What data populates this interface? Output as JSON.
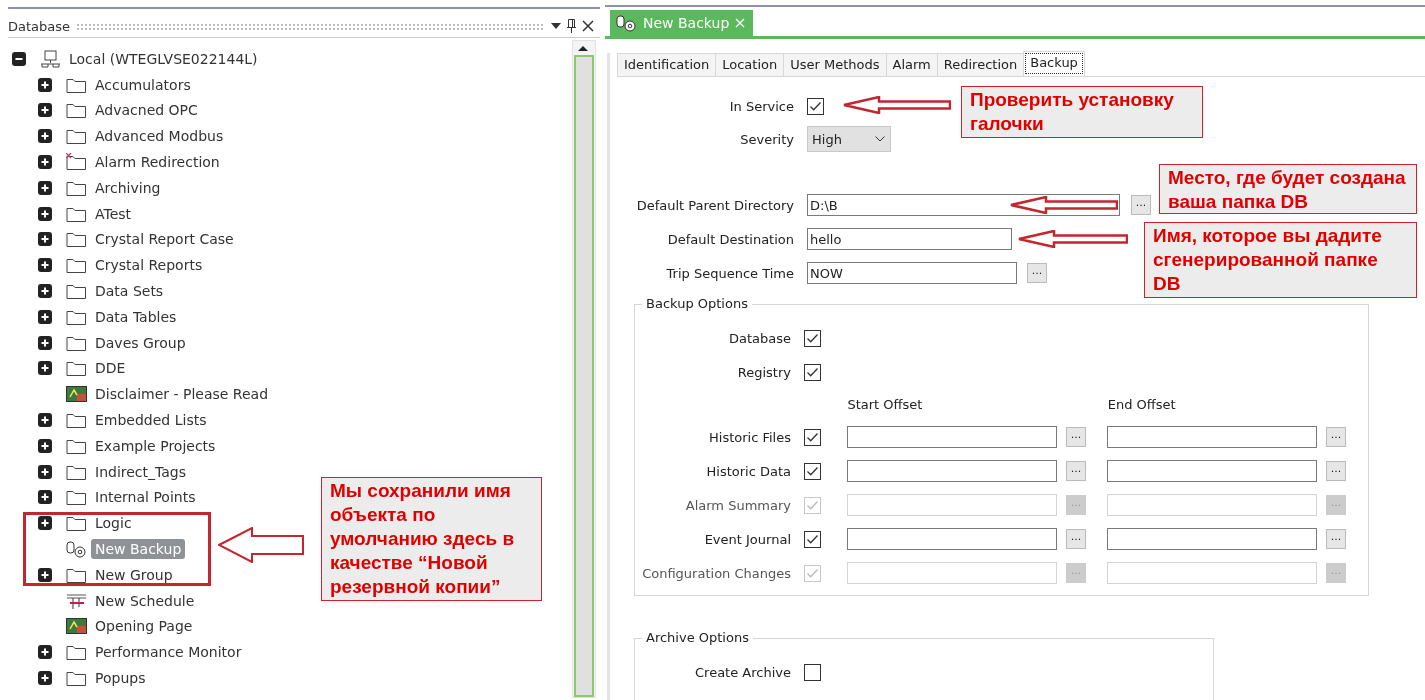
{
  "database_panel": {
    "title": "Database",
    "root": {
      "label": "Local (WTEGLVSE022144L)",
      "expanded": true,
      "children": [
        {
          "label": "Accumulators",
          "kind": "folder",
          "expandable": true,
          "selected": false
        },
        {
          "label": "Advacned OPC",
          "kind": "folder",
          "expandable": true,
          "selected": false
        },
        {
          "label": "Advanced Modbus",
          "kind": "folder",
          "expandable": true,
          "selected": false
        },
        {
          "label": "Alarm Redirection",
          "kind": "marked-folder",
          "expandable": true,
          "selected": false
        },
        {
          "label": "Archiving",
          "kind": "folder",
          "expandable": true,
          "selected": false
        },
        {
          "label": "ATest",
          "kind": "folder",
          "expandable": true,
          "selected": false
        },
        {
          "label": "Crystal Report Case",
          "kind": "folder",
          "expandable": true,
          "selected": false
        },
        {
          "label": "Crystal Reports",
          "kind": "folder",
          "expandable": true,
          "selected": false
        },
        {
          "label": "Data Sets",
          "kind": "folder",
          "expandable": true,
          "selected": false
        },
        {
          "label": "Data Tables",
          "kind": "folder",
          "expandable": true,
          "selected": false
        },
        {
          "label": "Daves Group",
          "kind": "folder",
          "expandable": true,
          "selected": false
        },
        {
          "label": "DDE",
          "kind": "folder",
          "expandable": true,
          "selected": false
        },
        {
          "label": "Disclaimer - Please Read",
          "kind": "page",
          "expandable": false,
          "selected": false
        },
        {
          "label": "Embedded Lists",
          "kind": "folder",
          "expandable": true,
          "selected": false
        },
        {
          "label": "Example Projects",
          "kind": "folder",
          "expandable": true,
          "selected": false
        },
        {
          "label": "Indirect_Tags",
          "kind": "folder",
          "expandable": true,
          "selected": false
        },
        {
          "label": "Internal Points",
          "kind": "folder",
          "expandable": true,
          "selected": false
        },
        {
          "label": "Logic",
          "kind": "folder",
          "expandable": true,
          "selected": false
        },
        {
          "label": "New Backup",
          "kind": "backup",
          "expandable": false,
          "selected": true
        },
        {
          "label": "New Group",
          "kind": "folder",
          "expandable": true,
          "selected": false
        },
        {
          "label": "New Schedule",
          "kind": "schedule",
          "expandable": false,
          "selected": false
        },
        {
          "label": "Opening Page",
          "kind": "page",
          "expandable": false,
          "selected": false
        },
        {
          "label": "Performance Monitor",
          "kind": "folder",
          "expandable": true,
          "selected": false
        },
        {
          "label": "Popups",
          "kind": "folder",
          "expandable": true,
          "selected": false
        }
      ]
    }
  },
  "document_tab": {
    "label": "New Backup"
  },
  "tabs": [
    {
      "label": "Identification",
      "selected": false
    },
    {
      "label": "Location",
      "selected": false
    },
    {
      "label": "User Methods",
      "selected": false
    },
    {
      "label": "Alarm",
      "selected": false
    },
    {
      "label": "Redirection",
      "selected": false
    },
    {
      "label": "Backup",
      "selected": true
    }
  ],
  "form": {
    "in_service": {
      "label": "In Service",
      "checked": true
    },
    "severity": {
      "label": "Severity",
      "value": "High"
    },
    "fields": [
      {
        "label": "Default Parent Directory",
        "value": "D:\\B",
        "button": "..."
      },
      {
        "label": "Default Destination",
        "value": "hello"
      },
      {
        "label": "Trip Sequence Time",
        "value": "NOW",
        "button": "..."
      }
    ]
  },
  "backup_options": {
    "title": "Backup Options",
    "checks": [
      {
        "label": "Database",
        "checked": true
      },
      {
        "label": "Registry",
        "checked": true
      }
    ],
    "columns": [
      "Start Offset",
      "End Offset"
    ],
    "rows": [
      {
        "label": "Historic Files",
        "checked": true,
        "disabled": false,
        "button": "..."
      },
      {
        "label": "Historic Data",
        "checked": true,
        "disabled": false,
        "button": "..."
      },
      {
        "label": "Alarm Summary",
        "checked": true,
        "disabled": true,
        "button": "..."
      },
      {
        "label": "Event Journal",
        "checked": true,
        "disabled": false,
        "button": "..."
      },
      {
        "label": "Configuration Changes",
        "checked": true,
        "disabled": true,
        "button": "..."
      }
    ]
  },
  "archive_options": {
    "title": "Archive Options",
    "checks": [
      {
        "label": "Create Archive",
        "checked": false
      }
    ]
  },
  "annotations": [
    {
      "kind": "callout",
      "text": "Проверить установку галочки"
    },
    {
      "kind": "callout",
      "text": "Место, где будет создана ваша папка DB"
    },
    {
      "kind": "callout",
      "text": "Имя, которое вы дадите сгенерированной папке DB"
    },
    {
      "kind": "callout",
      "text": "Мы сохранили имя объекта по умолчанию здесь в качестве “Новой резервной копии”"
    },
    {
      "kind": "highlight"
    }
  ]
}
